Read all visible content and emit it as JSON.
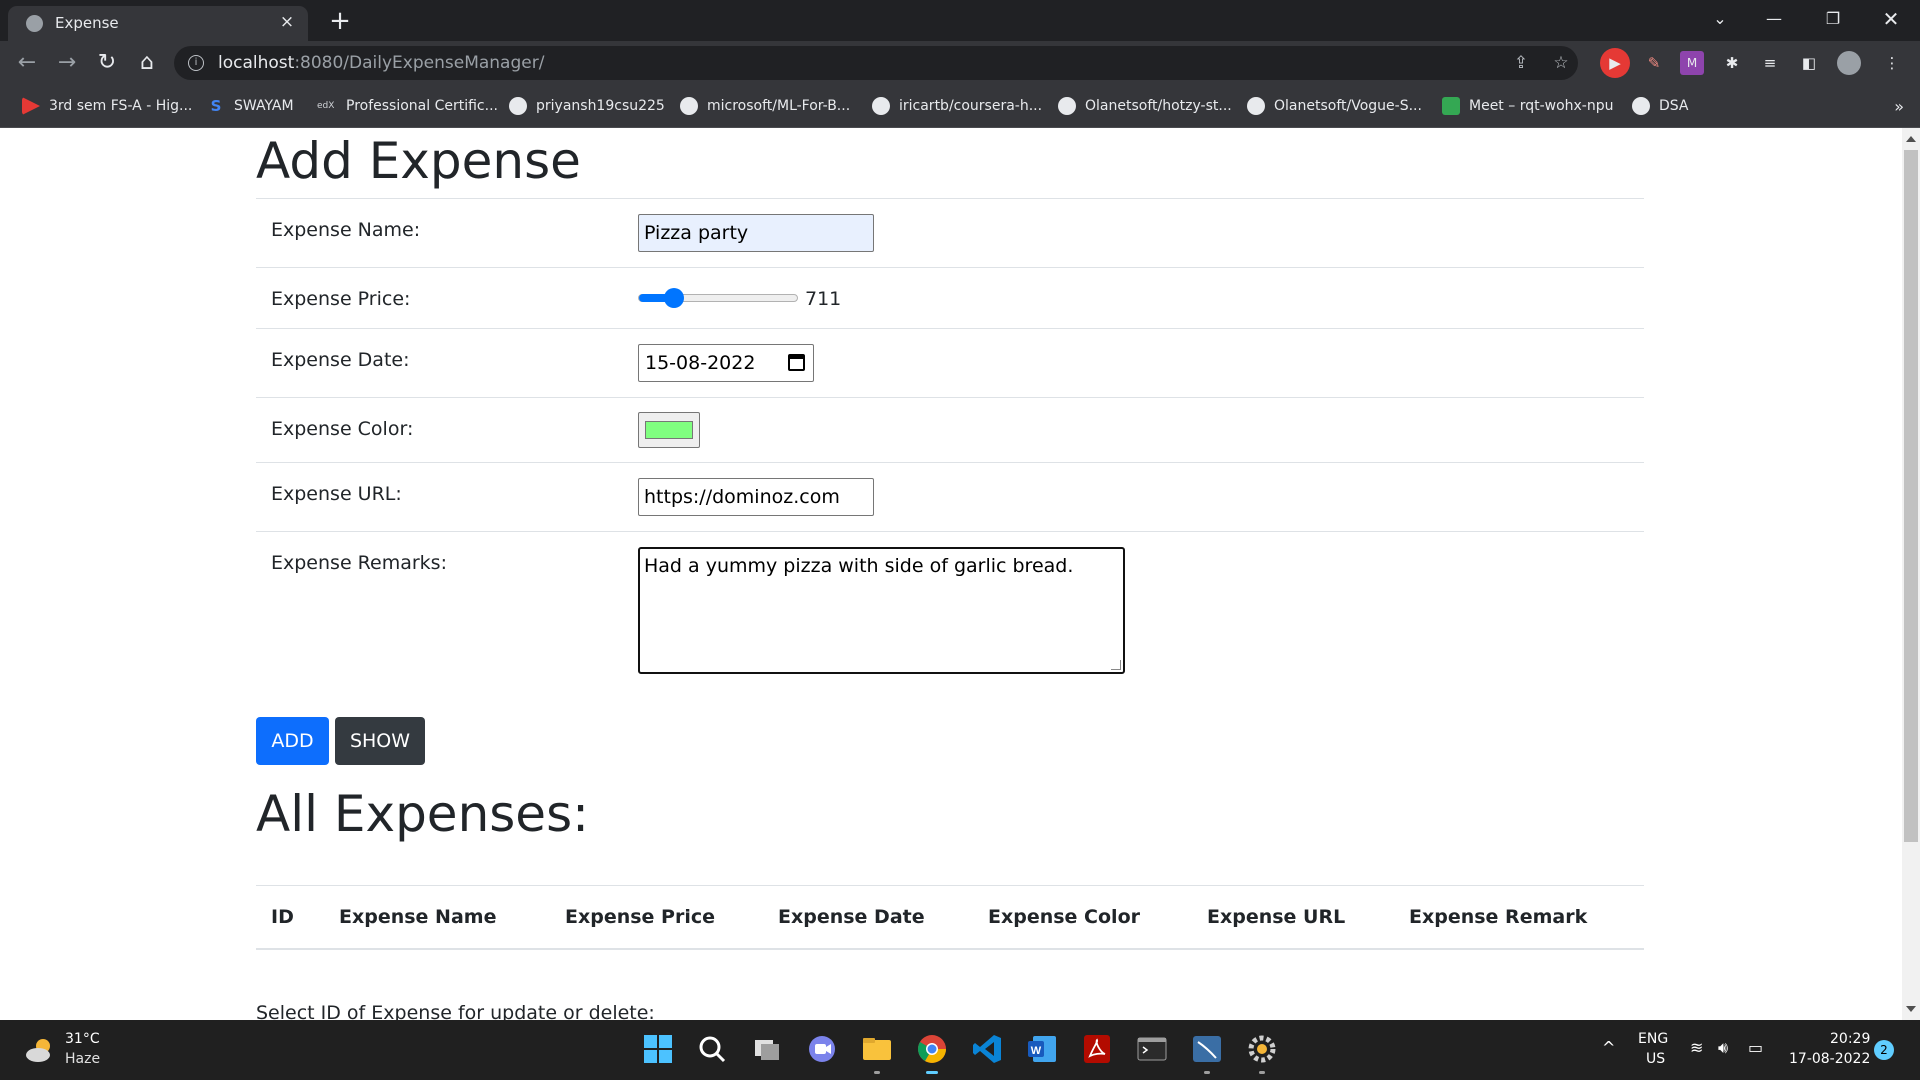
{
  "browser": {
    "tab_title": "Expense",
    "tab_close": "×",
    "new_tab": "+",
    "url_host": "localhost",
    "url_rest": ":8080/DailyExpenseManager/",
    "bookmarks": [
      {
        "label": "3rd sem FS-A - Hig...",
        "icon": "youtube-icon"
      },
      {
        "label": "SWAYAM",
        "icon": "swayam-icon"
      },
      {
        "label": "Professional Certific...",
        "icon": "edx-icon"
      },
      {
        "label": "priyansh19csu225",
        "icon": "github-icon"
      },
      {
        "label": "microsoft/ML-For-B...",
        "icon": "github-icon"
      },
      {
        "label": "iricartb/coursera-h...",
        "icon": "github-icon"
      },
      {
        "label": "Olanetsoft/hotzy-st...",
        "icon": "github-icon"
      },
      {
        "label": "Olanetsoft/Vogue-S...",
        "icon": "github-icon"
      },
      {
        "label": "Meet – rqt-wohx-npu",
        "icon": "meet-icon"
      },
      {
        "label": "DSA",
        "icon": "github-icon"
      }
    ],
    "more_bookmarks": "»"
  },
  "page": {
    "add_title": "Add Expense",
    "form": {
      "name_label": "Expense Name:",
      "name_value": "Pizza party",
      "price_label": "Expense Price:",
      "price_value": "711",
      "price_slider_fraction": 0.18,
      "date_label": "Expense Date:",
      "date_value": "15-08-2022",
      "color_label": "Expense Color:",
      "color_value": "#80ff80",
      "url_label": "Expense URL:",
      "url_value": "https://dominoz.com",
      "remarks_label": "Expense Remarks:",
      "remarks_value": "Had a yummy pizza with side of garlic bread."
    },
    "buttons": {
      "add": "ADD",
      "show": "SHOW"
    },
    "list_title": "All Expenses:",
    "table_headers": [
      "ID",
      "Expense Name",
      "Expense Price",
      "Expense Date",
      "Expense Color",
      "Expense URL",
      "Expense Remark"
    ],
    "select_note": "Select ID of Expense for update or delete:"
  },
  "taskbar": {
    "temperature": "31°C",
    "weather": "Haze",
    "lang": "ENG",
    "region": "US",
    "time": "20:29",
    "date": "17-08-2022",
    "notifications": "2"
  },
  "colors": {
    "primary": "#0d6efd",
    "dark": "#343a40",
    "accent": "#0075ff"
  }
}
